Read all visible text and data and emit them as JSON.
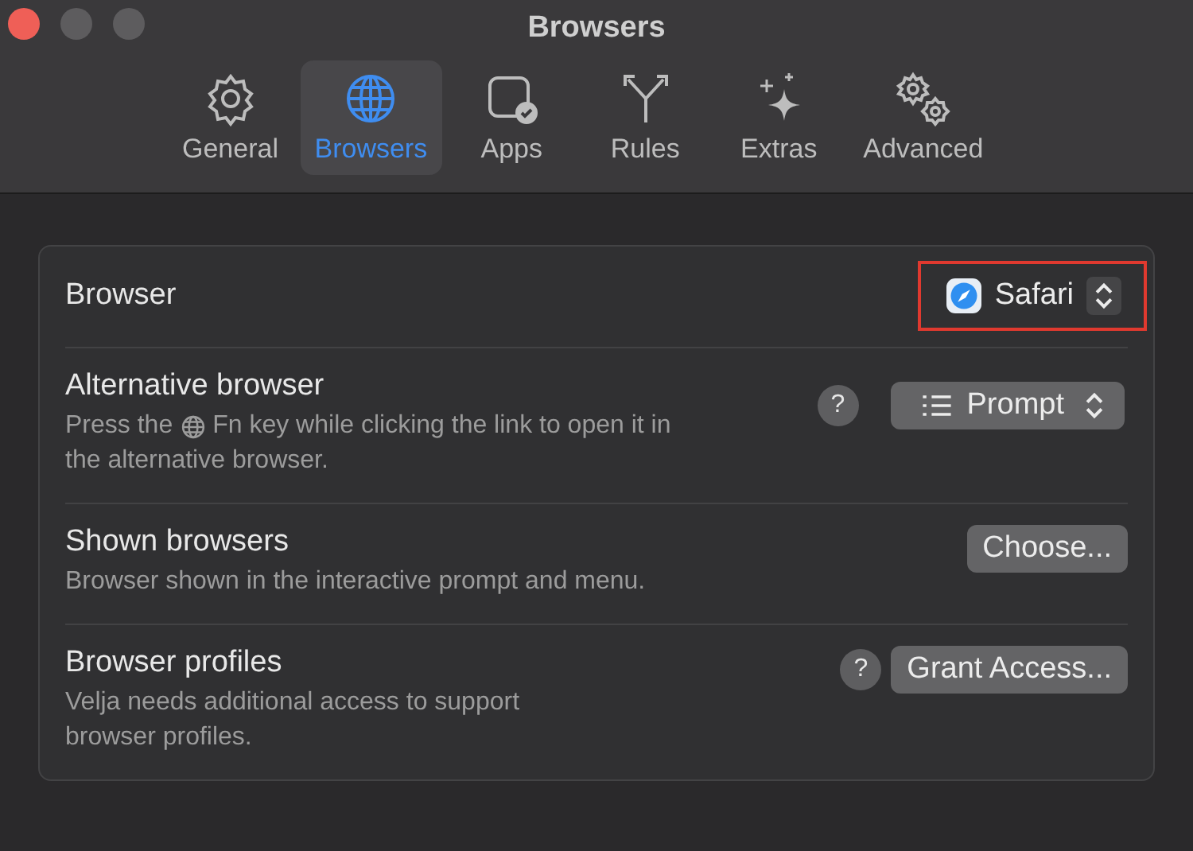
{
  "window": {
    "title": "Browsers"
  },
  "tabs": [
    {
      "label": "General",
      "selected": false
    },
    {
      "label": "Browsers",
      "selected": true
    },
    {
      "label": "Apps",
      "selected": false
    },
    {
      "label": "Rules",
      "selected": false
    },
    {
      "label": "Extras",
      "selected": false
    },
    {
      "label": "Advanced",
      "selected": false
    }
  ],
  "settings": [
    {
      "label": "Browser",
      "kind": "popup",
      "value": "Safari",
      "highlighted": true
    },
    {
      "label": "Alternative browser",
      "kind": "popup",
      "value": "Prompt",
      "highlighted": false,
      "help": "?",
      "description": [
        [
          {
            "kind": "text",
            "text": "Press the"
          },
          {
            "kind": "icon"
          },
          {
            "kind": "text",
            "text": "Fn key while clicking the link to open it in"
          }
        ],
        [
          {
            "kind": "text",
            "text": "the alternative browser."
          }
        ]
      ]
    },
    {
      "label": "Shown browsers",
      "kind": "button",
      "value": "Choose...",
      "description": [
        [
          {
            "kind": "text",
            "text": "Browser shown in the interactive prompt and menu."
          }
        ]
      ]
    },
    {
      "label": "Browser profiles",
      "kind": "button",
      "value": "Grant Access...",
      "help": "?",
      "description": [
        [
          {
            "kind": "text",
            "text": "Velja needs additional access to support"
          }
        ],
        [
          {
            "kind": "text",
            "text": "browser profiles."
          }
        ]
      ]
    }
  ]
}
